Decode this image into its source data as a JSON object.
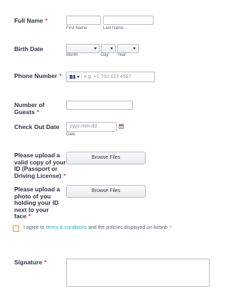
{
  "full_name": {
    "label": "Full Name",
    "required_mark": "*",
    "first_sublabel": "First Name",
    "last_sublabel": "Last Name"
  },
  "birth_date": {
    "label": "Birth Date",
    "month_sublabel": "Month",
    "day_sublabel": "Day",
    "year_sublabel": "Year"
  },
  "phone": {
    "label": "Phone Number",
    "required_mark": "*",
    "placeholder": "e.g. +1 702 123 4567",
    "flag": "uk-flag-icon"
  },
  "guests": {
    "label_line1": "Number of",
    "label_line2": "Guests",
    "required_mark": "*"
  },
  "checkout": {
    "label": "Check Out Date",
    "placeholder": "yyyy-mm-dd",
    "sublabel": "Date",
    "icon": "calendar-icon"
  },
  "id_upload": {
    "label_lines": [
      "Please upload a",
      "valid copy of your",
      "ID (Passport or",
      "Driving License)"
    ],
    "required_mark": "*",
    "button_label": "Browse Files"
  },
  "photo_upload": {
    "label_lines": [
      "Please upload a",
      "photo of you",
      "holding your ID",
      "next to your",
      "face"
    ],
    "required_mark": "*",
    "button_label": "Browse Files"
  },
  "agreement": {
    "text_before": "I agree to ",
    "link_text": "terms & conditions",
    "text_after": " and the policies displayed on Airbnb",
    "required_mark": "*"
  },
  "signature": {
    "label": "Signature",
    "required_mark": "*"
  },
  "colors": {
    "required": "#f23a3c",
    "link": "#2aa9d8",
    "label": "#2c3345",
    "border": "#b8bdc9",
    "checkbox": "#e0953c"
  }
}
